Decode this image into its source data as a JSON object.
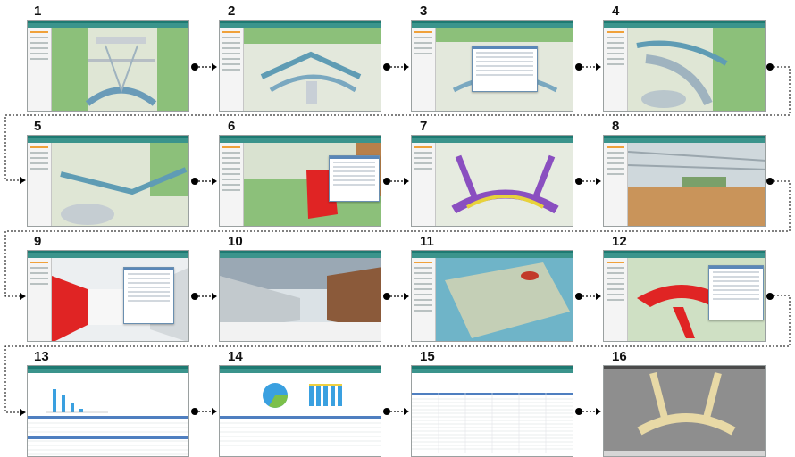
{
  "panels": [
    {
      "number": "1"
    },
    {
      "number": "2"
    },
    {
      "number": "3"
    },
    {
      "number": "4"
    },
    {
      "number": "5"
    },
    {
      "number": "6"
    },
    {
      "number": "7"
    },
    {
      "number": "8"
    },
    {
      "number": "9"
    },
    {
      "number": "10"
    },
    {
      "number": "11"
    },
    {
      "number": "12"
    },
    {
      "number": "13"
    },
    {
      "number": "14"
    },
    {
      "number": "15"
    },
    {
      "number": "16"
    }
  ],
  "colors": {
    "header": "#1e7a72",
    "nav": "#3b948c",
    "sidebar_highlight": "#f0a13a",
    "terrain": "#dfe6d5",
    "grass": "#7fb86a",
    "highlight_red": "#e02424",
    "chart_blue": "#3aa0e0",
    "pie_green": "#7cc04a",
    "connector": "#000000"
  }
}
